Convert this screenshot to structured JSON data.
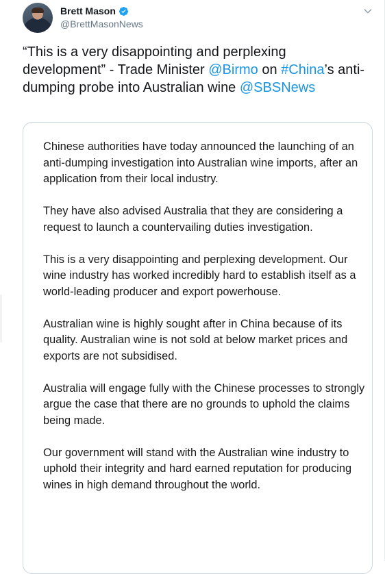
{
  "author": {
    "display_name": "Brett Mason",
    "handle": "@BrettMasonNews",
    "verified": true
  },
  "tweet": {
    "text_parts": [
      {
        "type": "text",
        "value": "“This is a very disappointing and perplexing development” - Trade Minister "
      },
      {
        "type": "mention",
        "value": "@Birmo"
      },
      {
        "type": "text",
        "value": " on "
      },
      {
        "type": "hashtag",
        "value": "#China"
      },
      {
        "type": "text",
        "value": "’s anti-dumping probe into Australian wine "
      },
      {
        "type": "mention",
        "value": "@SBSNews"
      }
    ]
  },
  "image_statement": {
    "paragraphs": [
      "Chinese authorities have today announced the launching of an anti-dumping investigation into Australian wine imports, after an application from their local industry.",
      "They have also advised Australia that they are considering a request to launch a countervailing duties investigation.",
      "This is a very disappointing and perplexing development. Our wine industry has worked incredibly hard to establish itself as a world-leading producer and export powerhouse.",
      "Australian wine is highly sought after in China because of its quality. Australian wine is not sold at below market prices and exports are not subsidised.",
      "Australia will engage fully with the Chinese processes to strongly argue the case that there are no grounds to uphold the claims being made.",
      "Our government will stand with the Australian wine industry to uphold their integrity and hard earned reputation for producing wines in high demand throughout the world."
    ]
  },
  "icons": {
    "verified": "verified-badge-icon",
    "caret": "chevron-down-icon"
  },
  "colors": {
    "link": "#1b95e0",
    "verified": "#1da1f2",
    "secondary_text": "#657786",
    "border": "#ccd6dd"
  }
}
